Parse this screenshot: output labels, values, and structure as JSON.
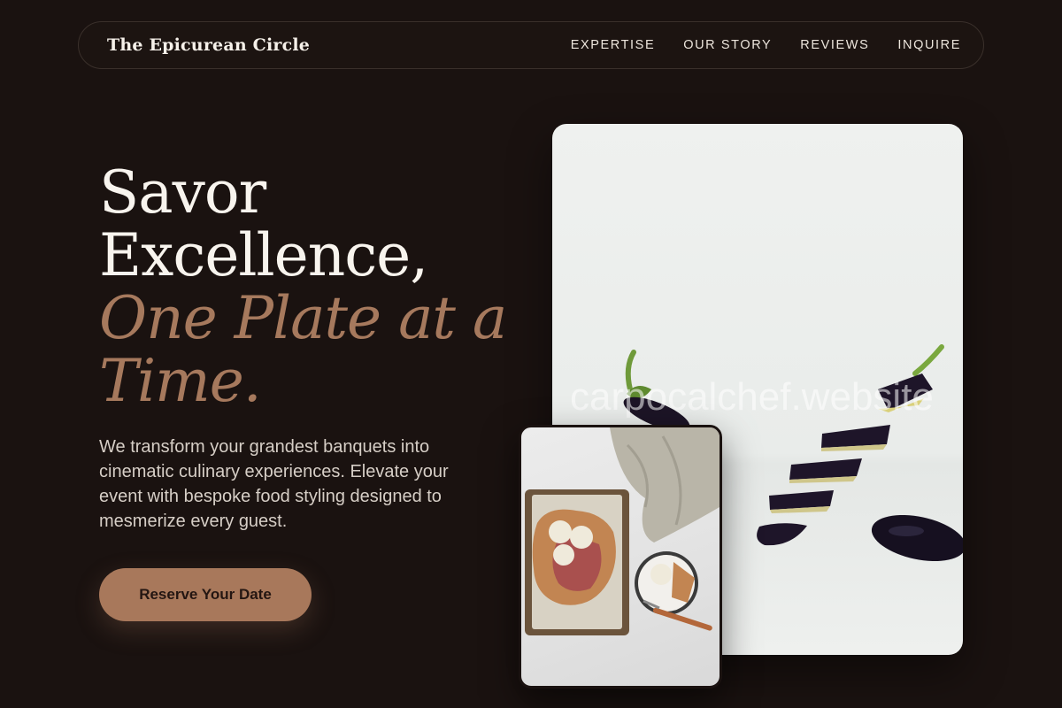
{
  "nav": {
    "brand": "The Epicurean Circle",
    "links": [
      "EXPERTISE",
      "OUR STORY",
      "REVIEWS",
      "INQUIRE"
    ]
  },
  "hero": {
    "title_line1": "Savor",
    "title_line2": "Excellence,",
    "title_accent_line1": "One Plate at a",
    "title_accent_line2": "Time.",
    "description": "We transform your grandest banquets into cinematic culinary experiences. Elevate your event with bespoke food styling designed to mesmerize every guest.",
    "cta_label": "Reserve Your Date"
  },
  "media": {
    "main_photo_alt": "Sliced eggplant floating on white background",
    "small_photo_alt": "Rustic fruit galette with scoops of ice cream",
    "watermark": "carpocalchef.website"
  },
  "colors": {
    "background": "#1a1210",
    "accent": "#a6795d",
    "button": "#a8785b",
    "text": "#f8f4ee"
  }
}
